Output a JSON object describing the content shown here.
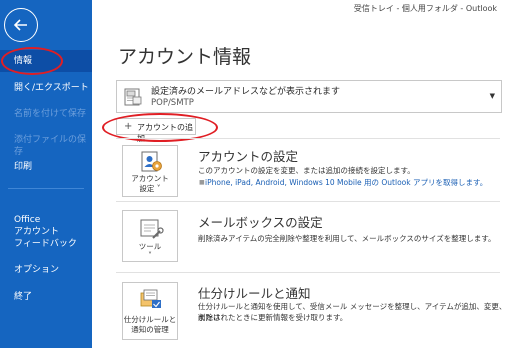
{
  "topbar": {
    "path": "受信トレイ - 個人用フォルダ - Outlook"
  },
  "sidebar": {
    "items": [
      {
        "label": "情報"
      },
      {
        "label": "開く/エクスポート"
      },
      {
        "label": "名前を付けて保存"
      },
      {
        "label": "添付ファイルの保存"
      },
      {
        "label": "印刷"
      },
      {
        "label": "Office\nアカウント"
      },
      {
        "label": "フィードバック"
      },
      {
        "label": "オプション"
      },
      {
        "label": "終了"
      }
    ]
  },
  "main": {
    "title": "アカウント情報",
    "account_select": {
      "text": "設定済みのメールアドレスなどが表示されます",
      "sub": "POP/SMTP"
    },
    "add_account": {
      "label": "アカウントの追加"
    },
    "sections": [
      {
        "tile_label_1": "アカウント",
        "tile_label_2": "設定 ˅",
        "title": "アカウントの設定",
        "desc": "このアカウントの設定を変更、または追加の接続を設定します。",
        "link": "iPhone, iPad, Android, Windows 10 Mobile 用の Outlook アプリを取得します。"
      },
      {
        "tile_label_1": "ツール",
        "tile_label_2": "˅",
        "title": "メールボックスの設定",
        "desc": "削除済みアイテムの完全削除や整理を利用して、メールボックスのサイズを整理します。"
      },
      {
        "tile_label_1": "仕分けルールと",
        "tile_label_2": "通知の管理",
        "title": "仕分けルールと通知",
        "desc_1": "仕分けルールと通知を使用して、受信メール メッセージを整理し、アイテムが追加、変更、または",
        "desc_2": "削除されたときに更新情報を受け取ります。"
      }
    ]
  },
  "colors": {
    "sidebar_bg": "#1565c0",
    "sidebar_active": "#0d4ea6",
    "annotation_red": "#e01e24",
    "link_blue": "#1a5fb4"
  }
}
